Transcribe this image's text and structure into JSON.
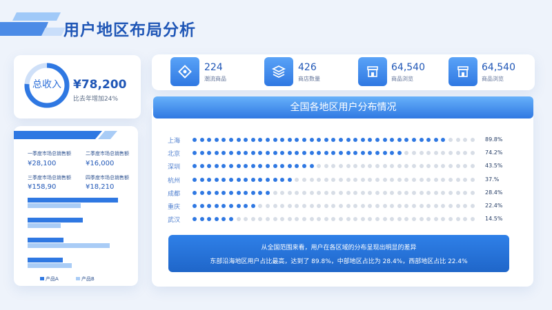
{
  "title": "用户地区布局分析",
  "revenue": {
    "ring_label": "总收入",
    "amount": "¥78,200",
    "growth_text": "比去年增加24%",
    "ring_fraction": 0.76
  },
  "stats": [
    {
      "icon": "diamond-icon",
      "value": "224",
      "label": "潮流商品"
    },
    {
      "icon": "layers-icon",
      "value": "426",
      "label": "商店数量"
    },
    {
      "icon": "store-icon",
      "value": "64,540",
      "label": "商品浏览"
    },
    {
      "icon": "store-icon",
      "value": "64,540",
      "label": "商品浏览"
    }
  ],
  "quarters": [
    {
      "label": "一季度市场总销售额",
      "value": "¥28,100"
    },
    {
      "label": "二季度市场总销售额",
      "value": "¥16,000"
    },
    {
      "label": "三季度市场总销售额",
      "value": "¥158,90"
    },
    {
      "label": "四季度市场总销售额",
      "value": "¥18,210"
    }
  ],
  "product_legend": {
    "a": "产品A",
    "b": "产品B"
  },
  "distribution": {
    "title": "全国各地区用户分布情况",
    "rows": [
      {
        "city": "上海",
        "pct_text": "89.8%",
        "value": 89.8
      },
      {
        "city": "北京",
        "pct_text": "74.2%",
        "value": 74.2
      },
      {
        "city": "深圳",
        "pct_text": "43.5%",
        "value": 43.5
      },
      {
        "city": "杭州",
        "pct_text": "37.%",
        "value": 37.0
      },
      {
        "city": "成都",
        "pct_text": "28.4%",
        "value": 28.4
      },
      {
        "city": "重庆",
        "pct_text": "22.4%",
        "value": 22.4
      },
      {
        "city": "武汉",
        "pct_text": "14.5%",
        "value": 14.5
      }
    ]
  },
  "summary": {
    "line1": "从全国范围来看，用户在各区域的分布呈现出明显的差异",
    "line2": "东部沿海地区用户占比最高，达到了 89.8%，中部地区占比为 28.4%，西部地区占比 22.4%"
  },
  "chart_data": {
    "type": "bar",
    "categories": [
      "",
      "",
      "",
      ""
    ],
    "series": [
      {
        "name": "产品A",
        "values": [
          9,
          5.5,
          3.6,
          3.5
        ]
      },
      {
        "name": "产品B",
        "values": [
          5.3,
          3.3,
          8.2,
          4.4
        ]
      }
    ]
  },
  "colors": {
    "primary": "#2f78e2",
    "light": "#a9ccf6",
    "dot_off": "#d7dde6"
  }
}
